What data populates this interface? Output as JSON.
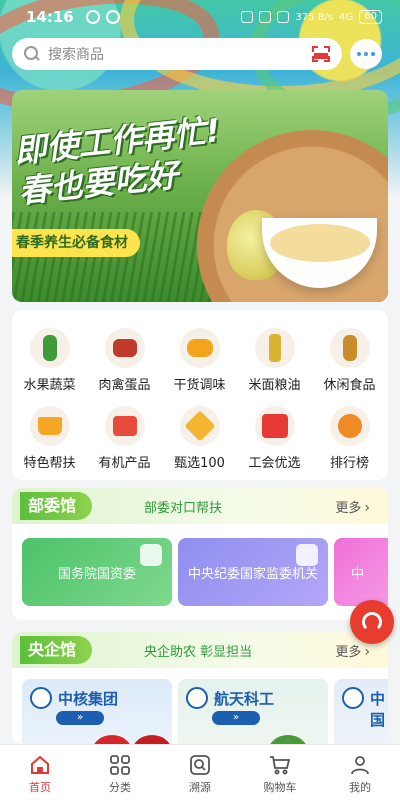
{
  "status_bar": {
    "time": "14:16",
    "net_speed": "375 B/s",
    "signal": "4G",
    "battery": "60"
  },
  "search": {
    "placeholder": "搜索商品"
  },
  "banner": {
    "title": "即使工作再忙!春也要吃好",
    "tag": "春季养生必备食材"
  },
  "categories": [
    {
      "label": "水果蔬菜",
      "icon": "vegetable-icon"
    },
    {
      "label": "肉禽蛋品",
      "icon": "meat-icon"
    },
    {
      "label": "干货调味",
      "icon": "honey-icon"
    },
    {
      "label": "米面粮油",
      "icon": "oil-icon"
    },
    {
      "label": "休闲食品",
      "icon": "snack-icon"
    },
    {
      "label": "特色帮扶",
      "icon": "crown-icon"
    },
    {
      "label": "有机产品",
      "icon": "gift-box-icon"
    },
    {
      "label": "甄选100",
      "icon": "diamond-icon"
    },
    {
      "label": "工会优选",
      "icon": "union-badge-icon"
    },
    {
      "label": "排行榜",
      "icon": "ranking-icon"
    }
  ],
  "ministry_section": {
    "title": "部委馆",
    "subtitle": "部委对口帮扶",
    "more": "更多",
    "tiles": [
      {
        "label": "国务院国资委",
        "color": "#4cc26a"
      },
      {
        "label": "中央纪委国家监委机关",
        "color": "#8f8ff0"
      },
      {
        "label": "中",
        "color": "#f06fd8"
      }
    ]
  },
  "central_section": {
    "title": "央企馆",
    "subtitle": "央企助农 彰显担当",
    "more": "更多",
    "brands": [
      {
        "name": "中核集团"
      },
      {
        "name": "航天科工"
      },
      {
        "name": "中国"
      }
    ]
  },
  "bottom_nav": [
    {
      "label": "首页",
      "icon": "home-icon",
      "active": true
    },
    {
      "label": "分类",
      "icon": "grid-icon",
      "active": false
    },
    {
      "label": "溯源",
      "icon": "trace-icon",
      "active": false
    },
    {
      "label": "购物车",
      "icon": "cart-icon",
      "active": false
    },
    {
      "label": "我的",
      "icon": "user-icon",
      "active": false
    }
  ],
  "colors": {
    "accent": "#e53935",
    "green": "#5bbf3b"
  }
}
